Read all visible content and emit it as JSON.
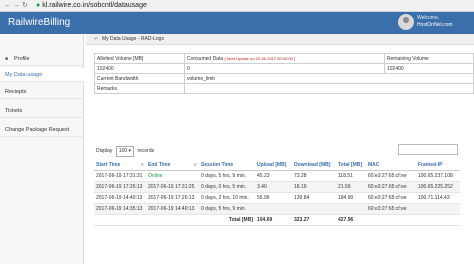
{
  "browser": {
    "url": "kl.railwire.co.in/sobcntl/datausage"
  },
  "header": {
    "brand": "RailwireBilling",
    "welcome": "Welcome,",
    "username": "HostOnNet.com"
  },
  "sidebar": {
    "items": [
      {
        "label": "Profile",
        "icon": "user-icon"
      },
      {
        "label": "My Data-usage",
        "icon": ""
      },
      {
        "label": "Reciepts",
        "icon": ""
      },
      {
        "label": "Tickets",
        "icon": ""
      },
      {
        "label": "Change Package Request",
        "icon": ""
      }
    ]
  },
  "breadcrumb": {
    "text": "My Data Usage - RAD-Logs"
  },
  "summary": {
    "h_allotted": "Allotted Volume [MB]",
    "h_consumed": "Consumed Data",
    "h_note": "[ Next Update on 20-06-2017 00:00:00 ]",
    "h_remaining": "Remaining Volume",
    "allotted": "102400",
    "consumed": "0",
    "remaining": "102400",
    "current_bandwidth": "Current Bandwidth",
    "volume_limit": "volume_limit",
    "remarks": "Remarks"
  },
  "controls": {
    "display": "Display",
    "length": "100",
    "records": "records"
  },
  "table": {
    "headers": [
      "Start Time",
      "End Time",
      "Session Time",
      "Upload [MB]",
      "Download [MB]",
      "Total [MB]",
      "MAC",
      "Framed-IP"
    ],
    "rows": [
      {
        "start": "2017-06-19 17:31:31",
        "end": "Online",
        "session": "0 days, 5 hrs, 9 min.",
        "upload": "45.23",
        "download": "73.28",
        "total": "118.51",
        "mac": "60:e3:27:65:cf:ee",
        "ip": "100.65.237.108"
      },
      {
        "start": "2017-06-19 17:26:13",
        "end": "2017-06-19 17:31:25",
        "session": "0 days, 0 hrs, 5 min.",
        "upload": "3.40",
        "download": "18.19",
        "total": "21.59",
        "mac": "60:e3:27:65:cf:ee",
        "ip": "100.65.225.252"
      },
      {
        "start": "2017-06-19 14:40:13",
        "end": "2017-06-19 17:26:13",
        "session": "0 days, 2 hrs, 10 min.",
        "upload": "55.06",
        "download": "139.84",
        "total": "194.90",
        "mac": "60:e3:27:65:cf:ee",
        "ip": "100.71.114.43"
      },
      {
        "start": "2017-06-19 14:35:13",
        "end": "2017-06-19 14:40:13",
        "session": "0 days, 5 hrs, 9 min.",
        "upload": "",
        "download": "",
        "total": "",
        "mac": "60:e3:27:65:cf:ee",
        "ip": ""
      }
    ],
    "totals": {
      "label": "Total [MB]",
      "upload": "104.69",
      "download": "323.27",
      "total": "427.96"
    }
  }
}
